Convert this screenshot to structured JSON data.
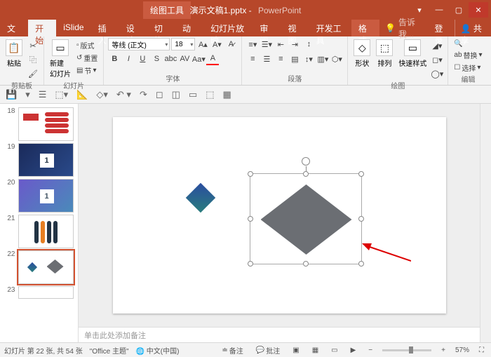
{
  "title": {
    "doc": "演示文稿1.pptx",
    "app": "PowerPoint",
    "tool_tab": "绘图工具"
  },
  "win": {
    "opts": "▾",
    "min": "—",
    "max": "▢",
    "close": "✕"
  },
  "menu": {
    "file": "文件",
    "home": "开始",
    "islide": "iSlide",
    "insert": "插入",
    "design": "设计",
    "transition": "切换",
    "animation": "动画",
    "slideshow": "幻灯片放映",
    "review": "审阅",
    "view": "视图",
    "dev": "开发工具",
    "format": "格式",
    "tell": "告诉我...",
    "login": "登录",
    "share": "共享"
  },
  "ribbon": {
    "clipboard": {
      "label": "剪贴板",
      "paste": "粘贴"
    },
    "slides": {
      "label": "幻灯片",
      "new": "新建\n幻灯片",
      "layout": "版式",
      "reset": "重置",
      "section": "节"
    },
    "font": {
      "label": "字体",
      "name": "等线 (正文)",
      "size": "18"
    },
    "paragraph": {
      "label": "段落"
    },
    "drawing": {
      "label": "绘图",
      "shapes": "形状",
      "arrange": "排列",
      "quick": "快速样式"
    },
    "editing": {
      "label": "编辑",
      "replace": "替换",
      "select": "选择"
    }
  },
  "notes_placeholder": "单击此处添加备注",
  "thumbs": [
    {
      "n": "18"
    },
    {
      "n": "19"
    },
    {
      "n": "20"
    },
    {
      "n": "21"
    },
    {
      "n": "22",
      "sel": true
    },
    {
      "n": "23"
    }
  ],
  "status": {
    "slide_info": "幻灯片 第 22 张, 共 54 张",
    "theme": "\"Office 主题\"",
    "lang": "中文(中国)",
    "notes": "备注",
    "comments": "批注",
    "zoom": "57%"
  }
}
